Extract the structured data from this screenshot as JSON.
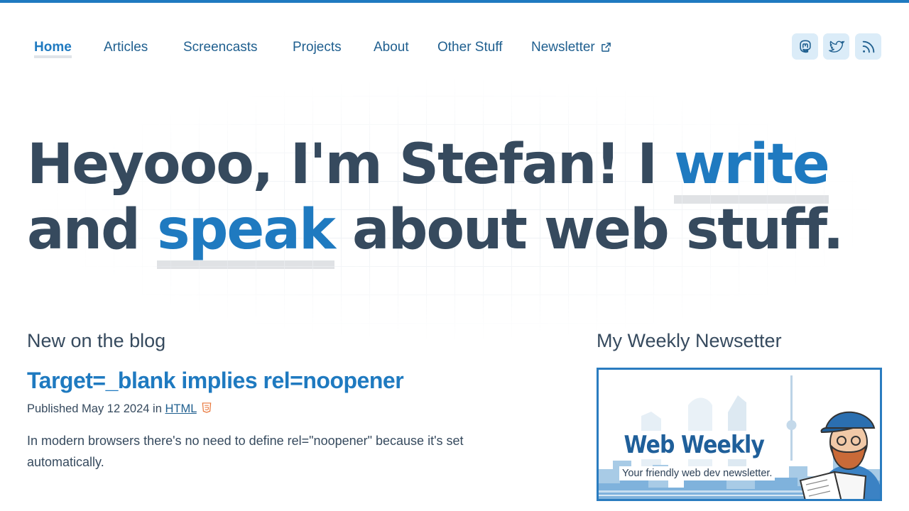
{
  "nav": {
    "items": [
      {
        "label": "Home"
      },
      {
        "label": "Articles"
      },
      {
        "label": "Screencasts"
      },
      {
        "label": "Projects"
      },
      {
        "label": "About"
      },
      {
        "label": "Other Stuff"
      },
      {
        "label": "Newsletter"
      }
    ]
  },
  "social": [
    "mastodon-icon",
    "twitter-icon",
    "rss-icon"
  ],
  "hero": {
    "part1": "Heyooo, I'm Stefan! I ",
    "highlight1": "write",
    "part2": "and ",
    "highlight2": "speak",
    "part3": " about web stuff."
  },
  "blog": {
    "heading": "New on the blog",
    "post_title": "Target=_blank implies rel=noopener",
    "published_prefix": "Published May 12 2024 in",
    "tag": "HTML",
    "excerpt": "In modern browsers there's no need to define rel=\"noopener\" because it's set automatically."
  },
  "newsletter": {
    "heading": "My Weekly Newsetter",
    "card_title": "Web Weekly",
    "card_subtitle": "Your friendly web dev newsletter."
  },
  "colors": {
    "accent": "#1f7ac0",
    "text": "#364a5e",
    "nav_text": "#1f5f8f"
  }
}
